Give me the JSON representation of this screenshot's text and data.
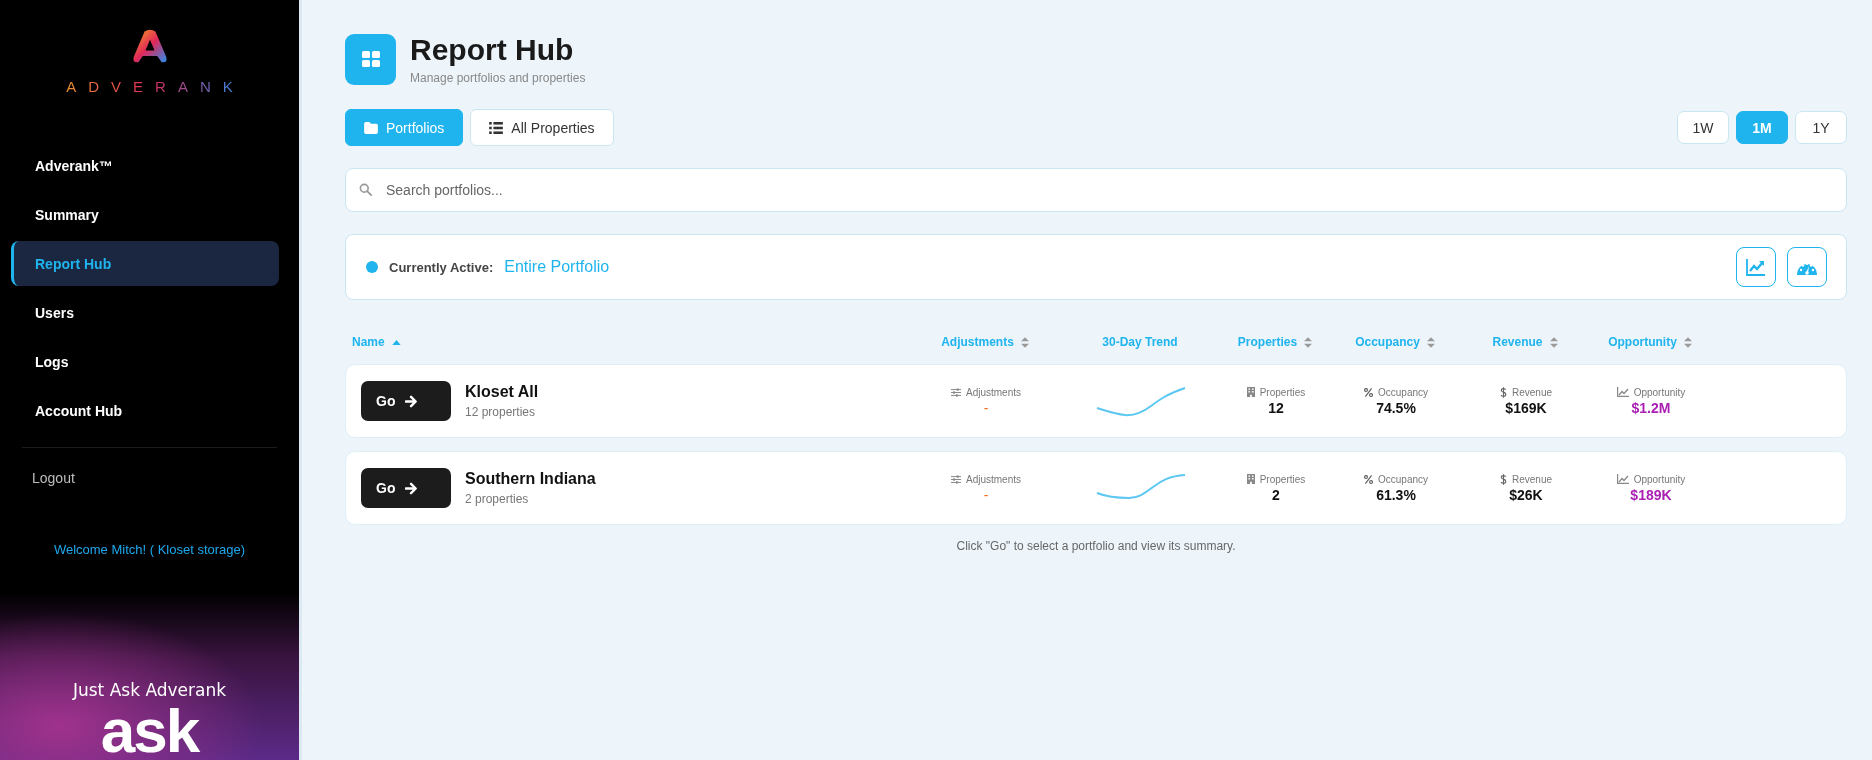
{
  "sidebar": {
    "brand": "ADVERANK",
    "items": [
      {
        "label": "Adverank™",
        "selected": false
      },
      {
        "label": "Summary",
        "selected": false
      },
      {
        "label": "Report Hub",
        "selected": true
      },
      {
        "label": "Users",
        "selected": false
      },
      {
        "label": "Logs",
        "selected": false
      },
      {
        "label": "Account Hub",
        "selected": false
      }
    ],
    "logout": "Logout",
    "welcome": "Welcome Mitch! ( Kloset storage)",
    "promo": {
      "tagline": "Just Ask Adverank",
      "word": "ask"
    }
  },
  "header": {
    "title": "Report Hub",
    "subtitle": "Manage portfolios and properties"
  },
  "view_tabs": [
    {
      "label": "Portfolios",
      "kind": "folder",
      "selected": true
    },
    {
      "label": "All Properties",
      "kind": "list",
      "selected": false
    }
  ],
  "periods": [
    {
      "label": "1W",
      "selected": false
    },
    {
      "label": "1M",
      "selected": true
    },
    {
      "label": "1Y",
      "selected": false
    }
  ],
  "search": {
    "placeholder": "Search portfolios..."
  },
  "active": {
    "label": "Currently Active:",
    "value": "Entire Portfolio"
  },
  "table": {
    "columns": [
      {
        "label": "Name",
        "sortable": true,
        "sorted": true
      },
      {
        "label": "Adjustments",
        "sortable": true,
        "sorted": false
      },
      {
        "label": "30-Day Trend",
        "sortable": false,
        "sorted": false
      },
      {
        "label": "Properties",
        "sortable": true,
        "sorted": false
      },
      {
        "label": "Occupancy",
        "sortable": true,
        "sorted": false
      },
      {
        "label": "Revenue",
        "sortable": true,
        "sorted": false
      },
      {
        "label": "Opportunity",
        "sortable": true,
        "sorted": false
      }
    ],
    "rows": [
      {
        "button": "Go",
        "name": "Kloset All",
        "count": "12 properties",
        "adjustments_label": "Adjustments",
        "adjustments": "-",
        "properties_label": "Properties",
        "properties": "12",
        "occupancy_label": "Occupancy",
        "occupancy": "74.5%",
        "revenue_label": "Revenue",
        "revenue": "$169K",
        "opportunity_label": "Opportunity",
        "opportunity": "$1.2M"
      },
      {
        "button": "Go",
        "name": "Southern Indiana",
        "count": "2 properties",
        "adjustments_label": "Adjustments",
        "adjustments": "-",
        "properties_label": "Properties",
        "properties": "2",
        "occupancy_label": "Occupancy",
        "occupancy": "61.3%",
        "revenue_label": "Revenue",
        "revenue": "$26K",
        "opportunity_label": "Opportunity",
        "opportunity": "$189K"
      }
    ]
  },
  "hint": "Click \"Go\" to select a portfolio and view its summary."
}
